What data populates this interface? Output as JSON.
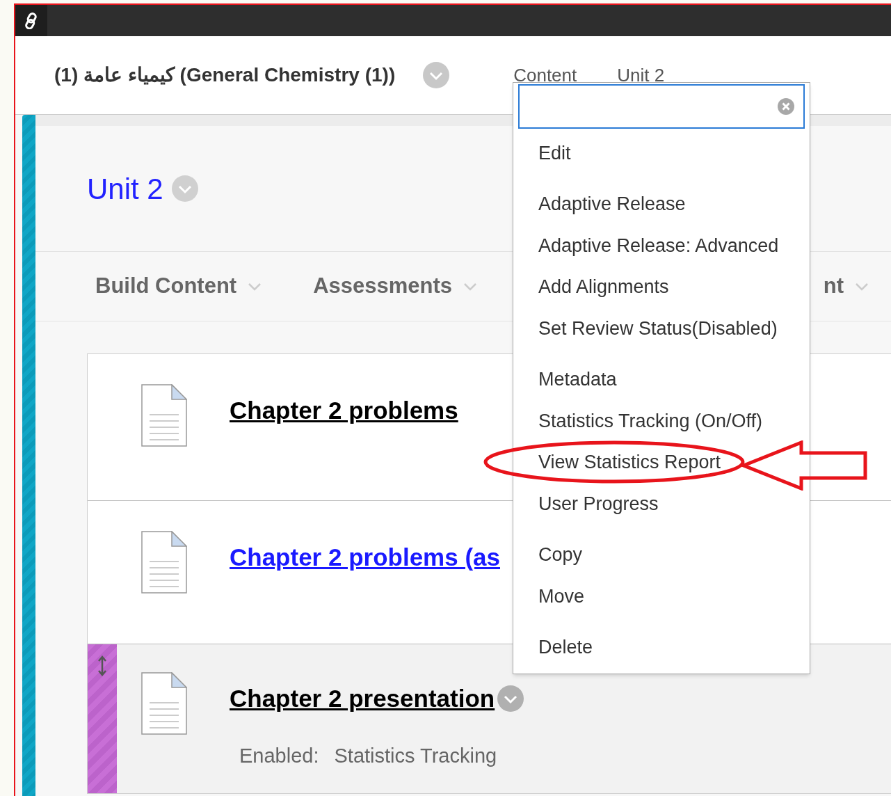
{
  "header": {
    "course_title": "(1) كيمياء عامة (General Chemistry (1))",
    "breadcrumbs": [
      "Content",
      "Unit 2"
    ]
  },
  "page_title": "Unit 2",
  "toolbar": [
    {
      "label": "Build Content"
    },
    {
      "label": "Assessments"
    },
    {
      "label": "nt"
    }
  ],
  "items": [
    {
      "title": "Chapter 2 problems",
      "visited": true,
      "selected": false
    },
    {
      "title": "Chapter 2 problems (as",
      "visited": false,
      "selected": false
    },
    {
      "title": "Chapter 2 presentation",
      "visited": true,
      "selected": true,
      "details": [
        {
          "label": "Enabled:",
          "value": "Statistics Tracking"
        }
      ]
    }
  ],
  "context_menu": {
    "groups": [
      [
        {
          "label": "Edit",
          "highlighted": false
        }
      ],
      [
        {
          "label": "Adaptive Release",
          "highlighted": false
        },
        {
          "label": "Adaptive Release: Advanced",
          "highlighted": false
        },
        {
          "label": "Add Alignments",
          "highlighted": false
        },
        {
          "label": "Set Review Status(Disabled)",
          "highlighted": false
        }
      ],
      [
        {
          "label": "Metadata",
          "highlighted": false
        },
        {
          "label": "Statistics Tracking (On/Off)",
          "highlighted": false
        },
        {
          "label": "View Statistics Report",
          "highlighted": true
        },
        {
          "label": "User Progress",
          "highlighted": false
        }
      ],
      [
        {
          "label": "Copy",
          "highlighted": false
        },
        {
          "label": "Move",
          "highlighted": false
        }
      ],
      [
        {
          "label": "Delete",
          "highlighted": false
        }
      ]
    ]
  }
}
